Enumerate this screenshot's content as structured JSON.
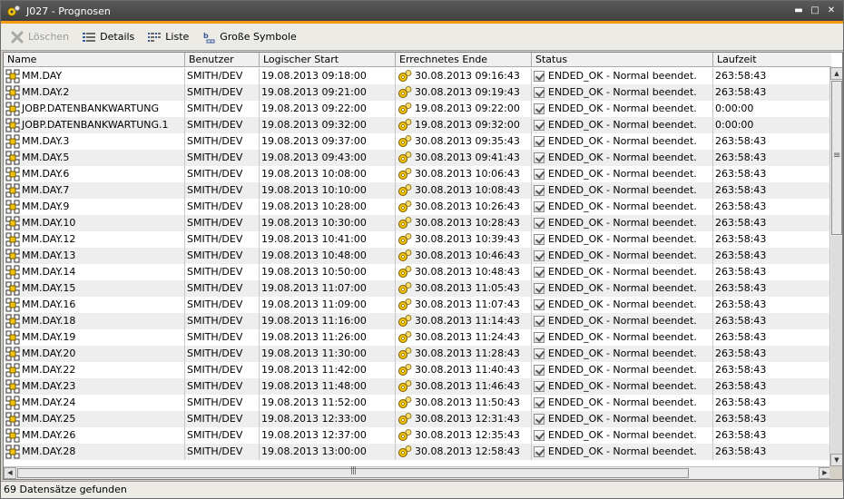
{
  "window": {
    "title": "J027 - Prognosen",
    "controls": {
      "minimize": "▬",
      "maximize": "□",
      "close": "✕"
    }
  },
  "toolbar": {
    "delete_label": "Löschen",
    "details_label": "Details",
    "list_label": "Liste",
    "large_icons_label": "Große Symbole"
  },
  "columns": {
    "name": "Name",
    "user": "Benutzer",
    "start": "Logischer Start",
    "end": "Errechnetes Ende",
    "status": "Status",
    "runtime": "Laufzeit"
  },
  "rows": [
    {
      "name": "MM.DAY",
      "user": "SMITH/DEV",
      "start": "19.08.2013 09:18:00",
      "end": "30.08.2013 09:16:43",
      "status": "ENDED_OK - Normal beendet.",
      "runtime": "263:58:43"
    },
    {
      "name": "MM.DAY.2",
      "user": "SMITH/DEV",
      "start": "19.08.2013 09:21:00",
      "end": "30.08.2013 09:19:43",
      "status": "ENDED_OK - Normal beendet.",
      "runtime": "263:58:43"
    },
    {
      "name": "JOBP.DATENBANKWARTUNG",
      "user": "SMITH/DEV",
      "start": "19.08.2013 09:22:00",
      "end": "19.08.2013 09:22:00",
      "status": "ENDED_OK - Normal beendet.",
      "runtime": "0:00:00"
    },
    {
      "name": "JOBP.DATENBANKWARTUNG.1",
      "user": "SMITH/DEV",
      "start": "19.08.2013 09:32:00",
      "end": "19.08.2013 09:32:00",
      "status": "ENDED_OK - Normal beendet.",
      "runtime": "0:00:00"
    },
    {
      "name": "MM.DAY.3",
      "user": "SMITH/DEV",
      "start": "19.08.2013 09:37:00",
      "end": "30.08.2013 09:35:43",
      "status": "ENDED_OK - Normal beendet.",
      "runtime": "263:58:43"
    },
    {
      "name": "MM.DAY.5",
      "user": "SMITH/DEV",
      "start": "19.08.2013 09:43:00",
      "end": "30.08.2013 09:41:43",
      "status": "ENDED_OK - Normal beendet.",
      "runtime": "263:58:43"
    },
    {
      "name": "MM.DAY.6",
      "user": "SMITH/DEV",
      "start": "19.08.2013 10:08:00",
      "end": "30.08.2013 10:06:43",
      "status": "ENDED_OK - Normal beendet.",
      "runtime": "263:58:43"
    },
    {
      "name": "MM.DAY.7",
      "user": "SMITH/DEV",
      "start": "19.08.2013 10:10:00",
      "end": "30.08.2013 10:08:43",
      "status": "ENDED_OK - Normal beendet.",
      "runtime": "263:58:43"
    },
    {
      "name": "MM.DAY.9",
      "user": "SMITH/DEV",
      "start": "19.08.2013 10:28:00",
      "end": "30.08.2013 10:26:43",
      "status": "ENDED_OK - Normal beendet.",
      "runtime": "263:58:43"
    },
    {
      "name": "MM.DAY.10",
      "user": "SMITH/DEV",
      "start": "19.08.2013 10:30:00",
      "end": "30.08.2013 10:28:43",
      "status": "ENDED_OK - Normal beendet.",
      "runtime": "263:58:43"
    },
    {
      "name": "MM.DAY.12",
      "user": "SMITH/DEV",
      "start": "19.08.2013 10:41:00",
      "end": "30.08.2013 10:39:43",
      "status": "ENDED_OK - Normal beendet.",
      "runtime": "263:58:43"
    },
    {
      "name": "MM.DAY.13",
      "user": "SMITH/DEV",
      "start": "19.08.2013 10:48:00",
      "end": "30.08.2013 10:46:43",
      "status": "ENDED_OK - Normal beendet.",
      "runtime": "263:58:43"
    },
    {
      "name": "MM.DAY.14",
      "user": "SMITH/DEV",
      "start": "19.08.2013 10:50:00",
      "end": "30.08.2013 10:48:43",
      "status": "ENDED_OK - Normal beendet.",
      "runtime": "263:58:43"
    },
    {
      "name": "MM.DAY.15",
      "user": "SMITH/DEV",
      "start": "19.08.2013 11:07:00",
      "end": "30.08.2013 11:05:43",
      "status": "ENDED_OK - Normal beendet.",
      "runtime": "263:58:43"
    },
    {
      "name": "MM.DAY.16",
      "user": "SMITH/DEV",
      "start": "19.08.2013 11:09:00",
      "end": "30.08.2013 11:07:43",
      "status": "ENDED_OK - Normal beendet.",
      "runtime": "263:58:43"
    },
    {
      "name": "MM.DAY.18",
      "user": "SMITH/DEV",
      "start": "19.08.2013 11:16:00",
      "end": "30.08.2013 11:14:43",
      "status": "ENDED_OK - Normal beendet.",
      "runtime": "263:58:43"
    },
    {
      "name": "MM.DAY.19",
      "user": "SMITH/DEV",
      "start": "19.08.2013 11:26:00",
      "end": "30.08.2013 11:24:43",
      "status": "ENDED_OK - Normal beendet.",
      "runtime": "263:58:43"
    },
    {
      "name": "MM.DAY.20",
      "user": "SMITH/DEV",
      "start": "19.08.2013 11:30:00",
      "end": "30.08.2013 11:28:43",
      "status": "ENDED_OK - Normal beendet.",
      "runtime": "263:58:43"
    },
    {
      "name": "MM.DAY.22",
      "user": "SMITH/DEV",
      "start": "19.08.2013 11:42:00",
      "end": "30.08.2013 11:40:43",
      "status": "ENDED_OK - Normal beendet.",
      "runtime": "263:58:43"
    },
    {
      "name": "MM.DAY.23",
      "user": "SMITH/DEV",
      "start": "19.08.2013 11:48:00",
      "end": "30.08.2013 11:46:43",
      "status": "ENDED_OK - Normal beendet.",
      "runtime": "263:58:43"
    },
    {
      "name": "MM.DAY.24",
      "user": "SMITH/DEV",
      "start": "19.08.2013 11:52:00",
      "end": "30.08.2013 11:50:43",
      "status": "ENDED_OK - Normal beendet.",
      "runtime": "263:58:43"
    },
    {
      "name": "MM.DAY.25",
      "user": "SMITH/DEV",
      "start": "19.08.2013 12:33:00",
      "end": "30.08.2013 12:31:43",
      "status": "ENDED_OK - Normal beendet.",
      "runtime": "263:58:43"
    },
    {
      "name": "MM.DAY.26",
      "user": "SMITH/DEV",
      "start": "19.08.2013 12:37:00",
      "end": "30.08.2013 12:35:43",
      "status": "ENDED_OK - Normal beendet.",
      "runtime": "263:58:43"
    },
    {
      "name": "MM.DAY.28",
      "user": "SMITH/DEV",
      "start": "19.08.2013 13:00:00",
      "end": "30.08.2013 12:58:43",
      "status": "ENDED_OK - Normal beendet.",
      "runtime": "263:58:43"
    }
  ],
  "status_bar": {
    "text": "69 Datensätze gefunden"
  },
  "scrollbars": {
    "up": "▲",
    "down": "▼",
    "left": "◀",
    "right": "▶"
  }
}
